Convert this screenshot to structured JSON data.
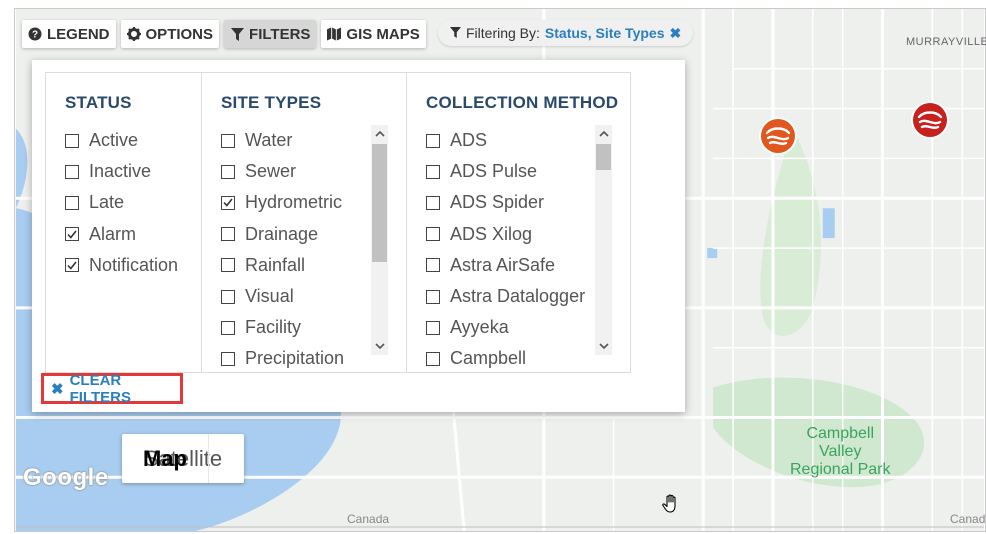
{
  "toolbar": {
    "legend": "LEGEND",
    "options": "OPTIONS",
    "filters": "FILTERS",
    "gis_maps": "GIS MAPS",
    "active_tab": "FILTERS"
  },
  "filtering_by": {
    "label": "Filtering By:",
    "values": "Status, Site Types"
  },
  "panel": {
    "status": {
      "title": "STATUS",
      "items": [
        {
          "label": "Active",
          "checked": false
        },
        {
          "label": "Inactive",
          "checked": false
        },
        {
          "label": "Late",
          "checked": false
        },
        {
          "label": "Alarm",
          "checked": true
        },
        {
          "label": "Notification",
          "checked": true
        }
      ]
    },
    "site_types": {
      "title": "SITE TYPES",
      "items": [
        {
          "label": "Water",
          "checked": false
        },
        {
          "label": "Sewer",
          "checked": false
        },
        {
          "label": "Hydrometric",
          "checked": true
        },
        {
          "label": "Drainage",
          "checked": false
        },
        {
          "label": "Rainfall",
          "checked": false
        },
        {
          "label": "Visual",
          "checked": false
        },
        {
          "label": "Facility",
          "checked": false
        },
        {
          "label": "Precipitation",
          "checked": false
        }
      ]
    },
    "collection_method": {
      "title": "COLLECTION METHOD",
      "items": [
        {
          "label": "ADS",
          "checked": false
        },
        {
          "label": "ADS Pulse",
          "checked": false
        },
        {
          "label": "ADS Spider",
          "checked": false
        },
        {
          "label": "ADS Xilog",
          "checked": false
        },
        {
          "label": "Astra AirSafe",
          "checked": false
        },
        {
          "label": "Astra Datalogger",
          "checked": false
        },
        {
          "label": "Ayyeka",
          "checked": false
        },
        {
          "label": "Campbell",
          "checked": false
        }
      ]
    },
    "clear_filters": "CLEAR FILTERS"
  },
  "map": {
    "type_map": "Map",
    "type_satellite": "Satellite",
    "selected_type": "Map",
    "google": "Google",
    "park_label": [
      "Campbell",
      "Valley",
      "Regional Park"
    ],
    "town_label": "MURRAYVILLE",
    "canada_left": "Canada",
    "canada_right": "Canad"
  },
  "colors": {
    "accent": "#2a7fc0",
    "heading": "#2a4a6b",
    "clear_border": "#e23838",
    "marker_orange": "#e2571d",
    "marker_red": "#c8201d",
    "park_green": "#3aa45e"
  }
}
